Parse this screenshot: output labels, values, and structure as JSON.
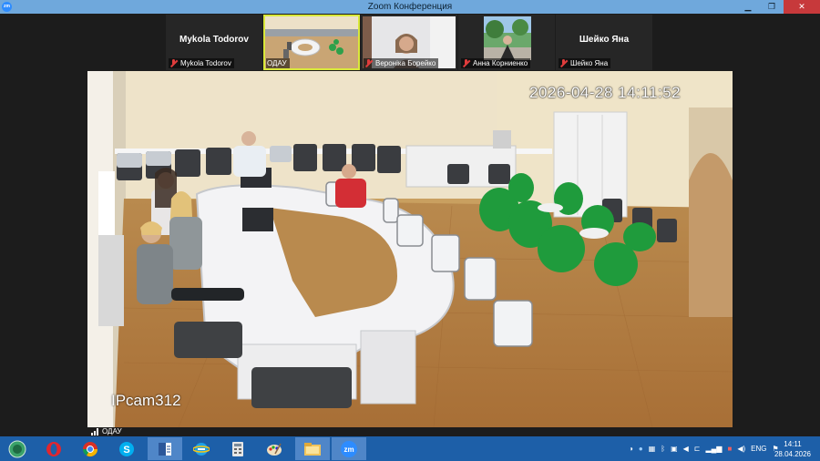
{
  "window": {
    "title": "Zoom Конференция",
    "app_badge": "zm",
    "minimize": "▁",
    "restore": "❐",
    "close": "✕"
  },
  "participants": [
    {
      "name": "Mykola Todorov",
      "label": "Mykola Todorov",
      "has_video": false,
      "muted": true
    },
    {
      "name": "ОДАУ",
      "label": "ОДАУ",
      "has_video": true,
      "muted": false,
      "active": true
    },
    {
      "name": "Вероніка Борейко",
      "label": "Вероніка Борейко",
      "has_video": true,
      "muted": true
    },
    {
      "name": "Анна Корниенко",
      "label": "Анна Корниенко",
      "has_video": true,
      "muted": true
    },
    {
      "name": "Шейко Яна",
      "label": "Шейко Яна",
      "has_video": false,
      "muted": true
    }
  ],
  "main_video": {
    "timestamp": "2026-04-28 14:11:52",
    "camera_label": "IPcam312",
    "speaker": "ОДАУ"
  },
  "taskbar": {
    "pinned": [
      "start-icon",
      "opera-icon",
      "chrome-icon",
      "skype-icon",
      "word-icon",
      "ie-icon",
      "calculator-icon",
      "paint-icon",
      "file-explorer-icon",
      "zoom-icon"
    ],
    "tray_language": "ENG",
    "clock_time": "14:11",
    "clock_date": "28.04.2026"
  },
  "colors": {
    "titlebar": "#6fa8dc",
    "taskbar": "#1d5fa8",
    "active_tile_border": "#d9e83a",
    "muted_icon": "#e03c3c"
  }
}
